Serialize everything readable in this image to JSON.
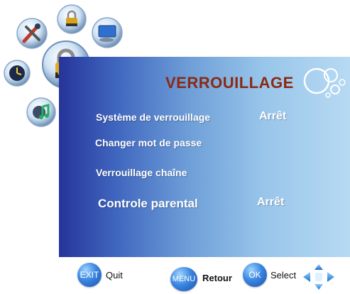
{
  "menu": {
    "title": "VERROUILLAGE",
    "items": [
      {
        "label": "Système de verrouillage",
        "value": "Arrêt"
      },
      {
        "label": "Changer mot de passe",
        "value": ""
      },
      {
        "label": "Verrouillage chaîne",
        "value": ""
      },
      {
        "label": "Controle parental",
        "value": "Arrêt"
      }
    ]
  },
  "footer": {
    "exit_key": "EXIT",
    "exit_label": "Quit",
    "menu_key": "MENU",
    "menu_label": "Retour",
    "ok_key": "OK",
    "ok_label": "Select"
  },
  "icons": {
    "selected": "lock-icon",
    "others": [
      "lock-icon",
      "tools-icon",
      "monitor-icon",
      "clock-icon",
      "music-icon"
    ]
  },
  "colors": {
    "title": "#8a2a12",
    "panel_left": "#26349a",
    "panel_right": "#b7daf3",
    "button": "#3a86e0"
  }
}
